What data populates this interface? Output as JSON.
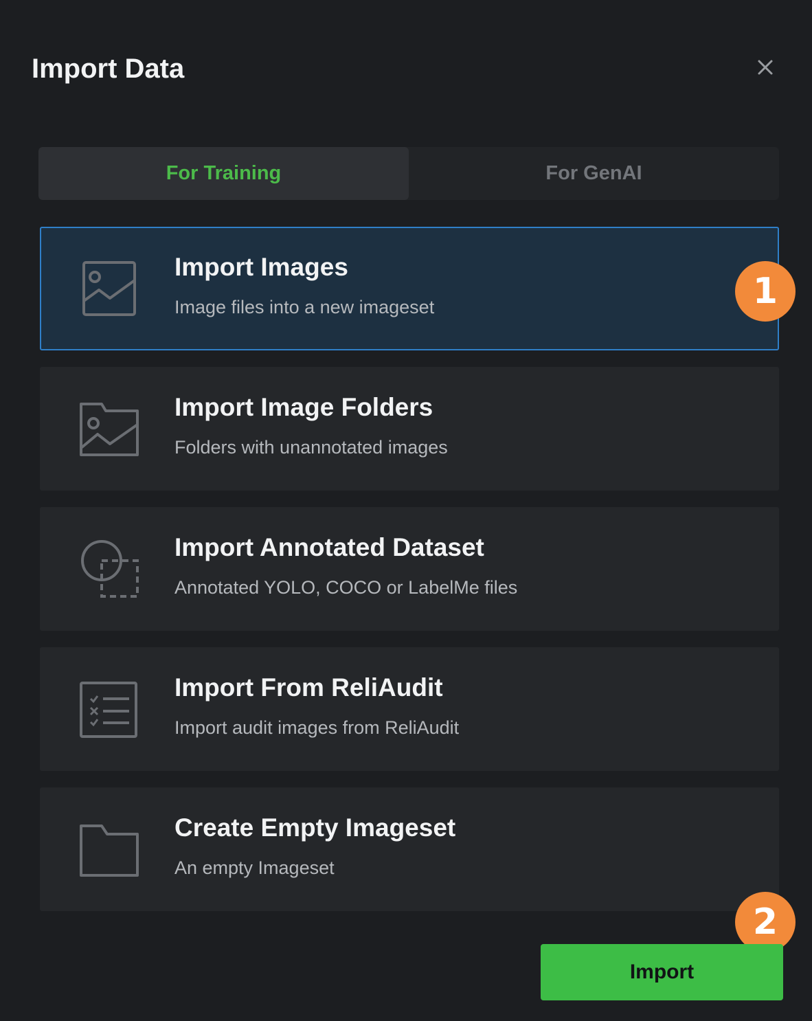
{
  "dialog": {
    "title": "Import Data",
    "close_icon": "close-icon"
  },
  "tabs": [
    {
      "label": "For Training",
      "active": true
    },
    {
      "label": "For GenAI",
      "active": false
    }
  ],
  "options": [
    {
      "title": "Import Images",
      "description": "Image files into a new imageset",
      "icon": "image-icon",
      "selected": true
    },
    {
      "title": "Import Image Folders",
      "description": "Folders with unannotated images",
      "icon": "image-folder-icon",
      "selected": false
    },
    {
      "title": "Import Annotated Dataset",
      "description": "Annotated YOLO, COCO or LabelMe files",
      "icon": "annotation-shapes-icon",
      "selected": false
    },
    {
      "title": "Import From ReliAudit",
      "description": "Import audit images from ReliAudit",
      "icon": "checklist-icon",
      "selected": false
    },
    {
      "title": "Create Empty Imageset",
      "description": "An empty Imageset",
      "icon": "folder-icon",
      "selected": false
    }
  ],
  "step_markers": [
    "1",
    "2"
  ],
  "footer": {
    "import_label": "Import"
  },
  "colors": {
    "accent_green": "#3dbd46",
    "tab_active_text": "#4cbb4a",
    "selection_border": "#2f7fc8",
    "step_marker": "#f28a3a"
  }
}
